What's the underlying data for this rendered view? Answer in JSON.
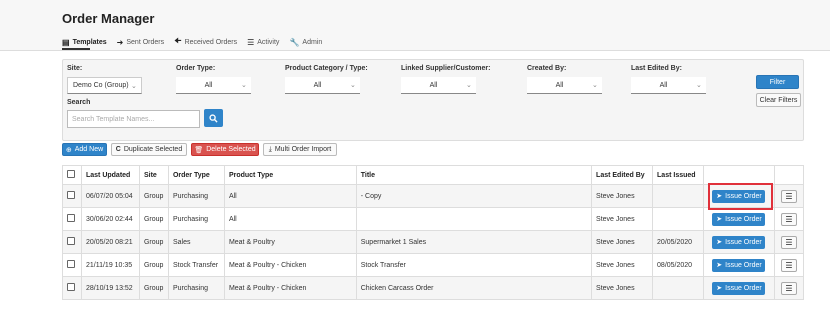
{
  "app": {
    "title": "Order Manager"
  },
  "nav": [
    {
      "label": "Templates",
      "icon": "inbox-icon",
      "active": true
    },
    {
      "label": "Sent Orders",
      "icon": "arrow-right-icon",
      "active": false
    },
    {
      "label": "Received Orders",
      "icon": "arrow-left-icon",
      "active": false
    },
    {
      "label": "Activity",
      "icon": "list-icon",
      "active": false
    },
    {
      "label": "Admin",
      "icon": "wrench-icon",
      "active": false
    }
  ],
  "filters": {
    "site_label": "Site:",
    "site_value": "Demo Co (Group)",
    "order_type_label": "Order Type:",
    "order_type_value": "All",
    "product_category_label": "Product Category / Type:",
    "product_category_value": "All",
    "linked_supplier_label": "Linked Supplier/Customer:",
    "linked_supplier_value": "All",
    "created_by_label": "Created By:",
    "created_by_value": "All",
    "last_edited_label": "Last Edited By:",
    "last_edited_value": "All",
    "search_label": "Search",
    "search_placeholder": "Search Template Names...",
    "filter_button": "Filter",
    "clear_button": "Clear Filters"
  },
  "toolbar": {
    "add_new": "Add New",
    "duplicate": "Duplicate Selected",
    "delete": "Delete Selected",
    "import": "Multi Order Import"
  },
  "table": {
    "headers": [
      "Last Updated",
      "Site",
      "Order Type",
      "Product Type",
      "Title",
      "Last Edited By",
      "Last Issued"
    ],
    "issue_label": "Issue Order",
    "rows": [
      {
        "updated": "06/07/20 05:04",
        "site": "Group",
        "order_type": "Purchasing",
        "product_type": "All",
        "title": "- Copy",
        "edited_by": "Steve Jones",
        "issued": ""
      },
      {
        "updated": "30/06/20 02:44",
        "site": "Group",
        "order_type": "Purchasing",
        "product_type": "All",
        "title": "",
        "edited_by": "Steve Jones",
        "issued": ""
      },
      {
        "updated": "20/05/20 08:21",
        "site": "Group",
        "order_type": "Sales",
        "product_type": "Meat & Poultry",
        "title": "Supermarket 1 Sales",
        "edited_by": "Steve Jones",
        "issued": "20/05/2020"
      },
      {
        "updated": "21/11/19 10:35",
        "site": "Group",
        "order_type": "Stock Transfer",
        "product_type": "Meat & Poultry - Chicken",
        "title": "Stock Transfer",
        "edited_by": "Steve Jones",
        "issued": "08/05/2020"
      },
      {
        "updated": "28/10/19 13:52",
        "site": "Group",
        "order_type": "Purchasing",
        "product_type": "Meat & Poultry - Chicken",
        "title": "Chicken Carcass Order",
        "edited_by": "Steve Jones",
        "issued": ""
      }
    ]
  },
  "colors": {
    "primary": "#2f84c9",
    "danger": "#d9534f",
    "highlight": "#e0303a"
  }
}
